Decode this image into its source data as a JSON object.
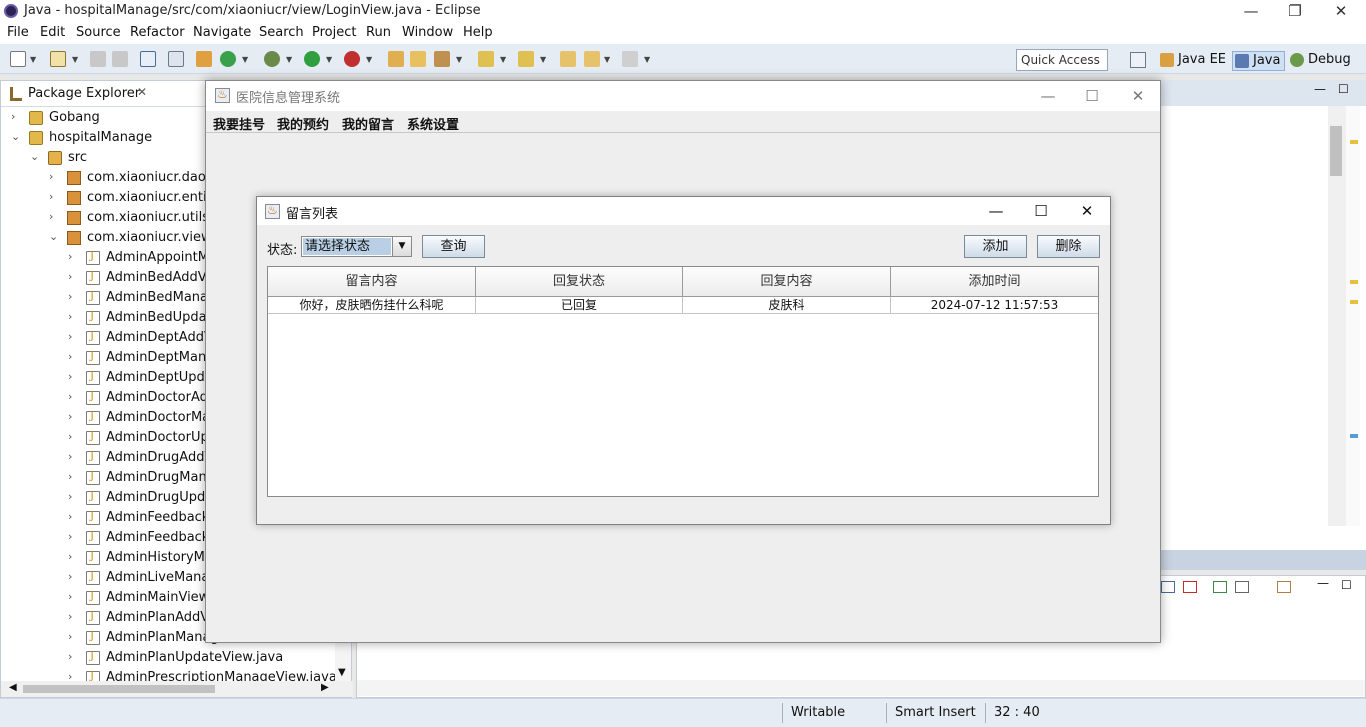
{
  "eclipse": {
    "title": "Java - hospitalManage/src/com/xiaoniucr/view/LoginView.java - Eclipse",
    "menu": [
      "File",
      "Edit",
      "Source",
      "Refactor",
      "Navigate",
      "Search",
      "Project",
      "Run",
      "Window",
      "Help"
    ],
    "quick_access": "Quick Access",
    "perspectives": [
      "Java EE",
      "Java",
      "Debug"
    ],
    "status": {
      "writable": "Writable",
      "insert_mode": "Smart Insert",
      "position": "32 : 40"
    }
  },
  "package_explorer": {
    "tab_label": "Package Explorer",
    "tree": [
      {
        "label": "Gobang",
        "type": "project",
        "depth": 0,
        "expanded": false
      },
      {
        "label": "hospitalManage",
        "type": "project",
        "depth": 0,
        "expanded": true
      },
      {
        "label": "src",
        "type": "src",
        "depth": 1,
        "expanded": true
      },
      {
        "label": "com.xiaoniucr.dao",
        "type": "package",
        "depth": 2,
        "expanded": false
      },
      {
        "label": "com.xiaoniucr.entity",
        "type": "package",
        "depth": 2,
        "expanded": false
      },
      {
        "label": "com.xiaoniucr.utils",
        "type": "package",
        "depth": 2,
        "expanded": false
      },
      {
        "label": "com.xiaoniucr.view",
        "type": "package",
        "depth": 2,
        "expanded": true
      },
      {
        "label": "AdminAppointMa",
        "type": "java",
        "depth": 3
      },
      {
        "label": "AdminBedAddVie",
        "type": "java",
        "depth": 3
      },
      {
        "label": "AdminBedManag",
        "type": "java",
        "depth": 3
      },
      {
        "label": "AdminBedUpdate",
        "type": "java",
        "depth": 3
      },
      {
        "label": "AdminDeptAddVi",
        "type": "java",
        "depth": 3
      },
      {
        "label": "AdminDeptMana",
        "type": "java",
        "depth": 3
      },
      {
        "label": "AdminDeptUpdat",
        "type": "java",
        "depth": 3
      },
      {
        "label": "AdminDoctorAdd",
        "type": "java",
        "depth": 3
      },
      {
        "label": "AdminDoctorMar",
        "type": "java",
        "depth": 3
      },
      {
        "label": "AdminDoctorUpd",
        "type": "java",
        "depth": 3
      },
      {
        "label": "AdminDrugAddVi",
        "type": "java",
        "depth": 3
      },
      {
        "label": "AdminDrugMana",
        "type": "java",
        "depth": 3
      },
      {
        "label": "AdminDrugUpdat",
        "type": "java",
        "depth": 3
      },
      {
        "label": "AdminFeedbackN",
        "type": "java",
        "depth": 3
      },
      {
        "label": "AdminFeedbackR",
        "type": "java",
        "depth": 3
      },
      {
        "label": "AdminHistoryMar",
        "type": "java",
        "depth": 3
      },
      {
        "label": "AdminLiveManag",
        "type": "java",
        "depth": 3
      },
      {
        "label": "AdminMainView.j",
        "type": "java",
        "depth": 3
      },
      {
        "label": "AdminPlanAddVie",
        "type": "java",
        "depth": 3
      },
      {
        "label": "AdminPlanManag",
        "type": "java",
        "depth": 3
      },
      {
        "label": "AdminPlanUpdateView.java",
        "type": "java",
        "depth": 3
      },
      {
        "label": "AdminPrescriptionManageView.java",
        "type": "java",
        "depth": 3
      }
    ]
  },
  "app_frame": {
    "title": "医院信息管理系统",
    "menu": [
      "我要挂号",
      "我的预约",
      "我的留言",
      "系统设置"
    ]
  },
  "dialog": {
    "title": "留言列表",
    "status_label": "状态:",
    "status_select": "请选择状态",
    "query_button": "查询",
    "add_button": "添加",
    "delete_button": "删除",
    "table": {
      "columns": [
        "留言内容",
        "回复状态",
        "回复内容",
        "添加时间"
      ],
      "rows": [
        [
          "你好，皮肤晒伤挂什么科呢",
          "已回复",
          "皮肤科",
          "2024-07-12 11:57:53"
        ]
      ]
    }
  }
}
